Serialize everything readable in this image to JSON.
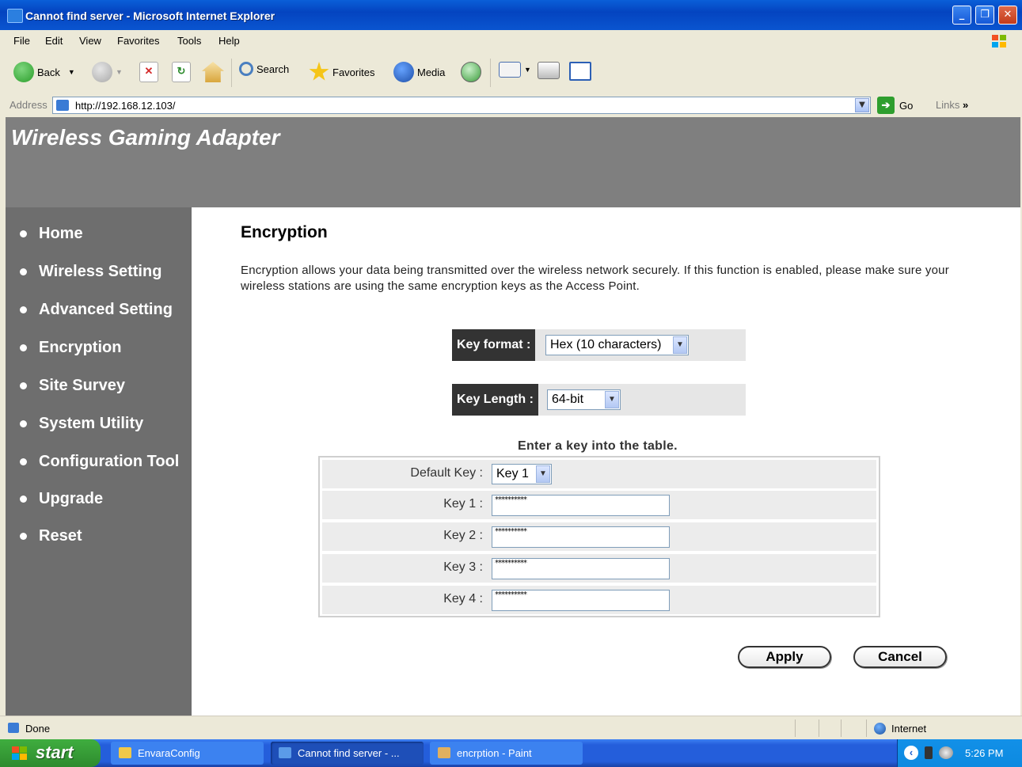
{
  "window": {
    "title": "Cannot find server - Microsoft Internet Explorer"
  },
  "menu": [
    "File",
    "Edit",
    "View",
    "Favorites",
    "Tools",
    "Help"
  ],
  "toolbar": {
    "back": "Back",
    "search": "Search",
    "favorites": "Favorites",
    "media": "Media"
  },
  "address": {
    "label": "Address",
    "url": "http://192.168.12.103/",
    "go": "Go",
    "links": "Links"
  },
  "page": {
    "brand": "Wireless Gaming Adapter",
    "nav": [
      "Home",
      "Wireless Setting",
      "Advanced Setting",
      "Encryption",
      "Site Survey",
      "System Utility",
      "Configuration Tool",
      "Upgrade",
      "Reset"
    ],
    "title": "Encryption",
    "description": "Encryption allows your data being transmitted over the wireless network securely. If this function is enabled, please make sure your wireless stations are using the same encryption keys as the Access Point.",
    "key_format": {
      "label": "Key format :",
      "value": "Hex (10 characters)"
    },
    "key_length": {
      "label": "Key Length :",
      "value": "64-bit"
    },
    "table_caption": "Enter a key into the table.",
    "default_key": {
      "label": "Default Key :",
      "value": "Key 1"
    },
    "keys": [
      {
        "label": "Key 1 :",
        "value": "**********"
      },
      {
        "label": "Key 2 :",
        "value": "**********"
      },
      {
        "label": "Key 3 :",
        "value": "**********"
      },
      {
        "label": "Key 4 :",
        "value": "**********"
      }
    ],
    "apply": "Apply",
    "cancel": "Cancel"
  },
  "status": {
    "text": "Done",
    "zone": "Internet"
  },
  "taskbar": {
    "start": "start",
    "tasks": [
      "EnvaraConfig",
      "Cannot find server - ...",
      "encrption - Paint"
    ],
    "clock": "5:26 PM"
  }
}
